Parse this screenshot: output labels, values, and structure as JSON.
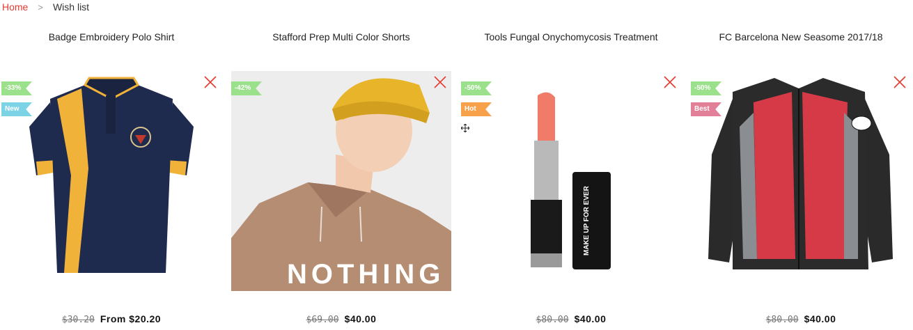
{
  "breadcrumb": {
    "home": "Home",
    "separator": ">",
    "current": "Wish list"
  },
  "colors": {
    "accent": "#e43a2f",
    "sale_badge": "#9be08a",
    "new_badge": "#7dd3e6",
    "hot_badge": "#f7a24a",
    "best_badge": "#e2809a"
  },
  "products": [
    {
      "title": "Badge Embroidery Polo Shirt",
      "badges": [
        "-33%",
        "New"
      ],
      "old_price": "$30.20",
      "price": "From $20.20",
      "image_icon": "polo-shirt-image"
    },
    {
      "title": "Stafford Prep Multi Color Shorts",
      "badges": [
        "-42%"
      ],
      "old_price": "$69.00",
      "price": "$40.00",
      "image_icon": "hoodie-model-image",
      "image_text": "NOTHING"
    },
    {
      "title": "Tools Fungal Onychomycosis Treatment",
      "badges": [
        "-50%",
        "Hot"
      ],
      "old_price": "$80.00",
      "price": "$40.00",
      "image_icon": "lipstick-image",
      "image_text": "MAKE UP FOR EVER"
    },
    {
      "title": "FC Barcelona New Seasome 2017/18",
      "badges": [
        "-50%",
        "Best"
      ],
      "old_price": "$80.00",
      "price": "$40.00",
      "image_icon": "moto-jacket-image"
    }
  ]
}
